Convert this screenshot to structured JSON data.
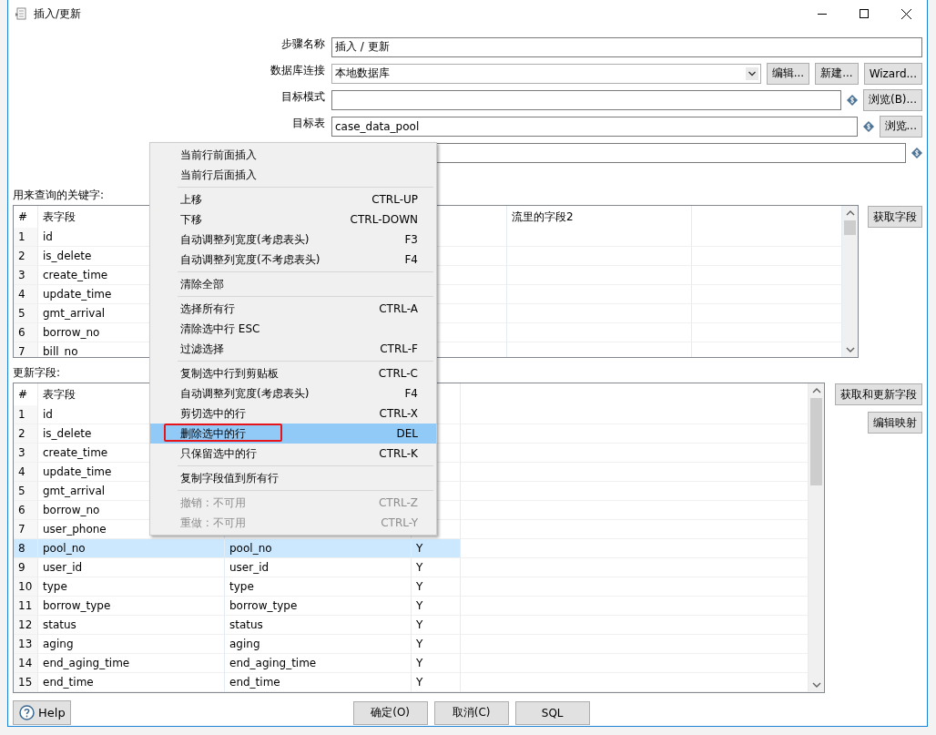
{
  "window": {
    "title": "插入/更新"
  },
  "form": [
    {
      "label": "步骤名称",
      "kind": "text",
      "value": "插入 / 更新"
    },
    {
      "label": "数据库连接",
      "kind": "combo",
      "value": "本地数据库",
      "buttons": [
        "编辑...",
        "新建...",
        "Wizard..."
      ]
    },
    {
      "label": "目标模式",
      "kind": "text",
      "variable": true,
      "buttons": [
        "浏览(B)..."
      ]
    },
    {
      "label": "目标表",
      "kind": "text",
      "value": "case_data_pool",
      "variable": true,
      "buttons": [
        "浏览..."
      ]
    },
    {
      "kind": "text",
      "variable": true
    }
  ],
  "key_section": {
    "title": "用来查询的关键字:",
    "columns": [
      {
        "label": "#"
      },
      {
        "label": "表字段"
      },
      {},
      {},
      {
        "label": "流里的字段2"
      },
      {}
    ],
    "rows": [
      {
        "num": "1",
        "field": "id"
      },
      {
        "num": "2",
        "field": "is_delete"
      },
      {
        "num": "3",
        "field": "create_time"
      },
      {
        "num": "4",
        "field": "update_time"
      },
      {
        "num": "5",
        "field": "gmt_arrival"
      },
      {
        "num": "6",
        "field": "borrow_no"
      },
      {
        "num": "7",
        "field": "bill_no"
      }
    ],
    "button": "获取字段"
  },
  "update_section": {
    "title": "更新字段:",
    "columns": [
      {
        "label": "#"
      },
      {
        "label": "表字段"
      },
      {},
      {},
      {}
    ],
    "rows": [
      {
        "num": "1",
        "field": "id",
        "selected": false
      },
      {
        "num": "2",
        "field": "is_delete",
        "selected": false
      },
      {
        "num": "3",
        "field": "create_time",
        "selected": false
      },
      {
        "num": "4",
        "field": "update_time",
        "selected": false
      },
      {
        "num": "5",
        "field": "gmt_arrival",
        "selected": false
      },
      {
        "num": "6",
        "field": "borrow_no",
        "selected": false
      },
      {
        "num": "7",
        "field": "user_phone",
        "selected": false
      },
      {
        "num": "8",
        "field": "pool_no",
        "stream": "pool_no",
        "update": "Y",
        "selected": true
      },
      {
        "num": "9",
        "field": "user_id",
        "stream": "user_id",
        "update": "Y",
        "selected": false
      },
      {
        "num": "10",
        "field": "type",
        "stream": "type",
        "update": "Y",
        "selected": false
      },
      {
        "num": "11",
        "field": "borrow_type",
        "stream": "borrow_type",
        "update": "Y",
        "selected": false
      },
      {
        "num": "12",
        "field": "status",
        "stream": "status",
        "update": "Y",
        "selected": false
      },
      {
        "num": "13",
        "field": "aging",
        "stream": "aging",
        "update": "Y",
        "selected": false
      },
      {
        "num": "14",
        "field": "end_aging_time",
        "stream": "end_aging_time",
        "update": "Y",
        "selected": false
      },
      {
        "num": "15",
        "field": "end_time",
        "stream": "end_time",
        "update": "Y",
        "selected": false
      }
    ],
    "buttons": [
      "获取和更新字段",
      "编辑映射"
    ]
  },
  "footer": {
    "help": "Help",
    "buttons": [
      "确定(O)",
      "取消(C)",
      "SQL"
    ]
  },
  "context_menu": [
    {
      "kind": "item",
      "label": "当前行前面插入",
      "disabled": false,
      "selected": false
    },
    {
      "kind": "item",
      "label": "当前行后面插入",
      "disabled": false,
      "selected": false
    },
    {
      "kind": "separator"
    },
    {
      "kind": "item",
      "label": "上移",
      "shortcut": "CTRL-UP",
      "disabled": false,
      "selected": false
    },
    {
      "kind": "item",
      "label": "下移",
      "shortcut": "CTRL-DOWN",
      "disabled": false,
      "selected": false
    },
    {
      "kind": "item",
      "label": "自动调整列宽度(考虑表头)",
      "shortcut": "F3",
      "disabled": false,
      "selected": false
    },
    {
      "kind": "item",
      "label": "自动调整列宽度(不考虑表头)",
      "shortcut": "F4",
      "disabled": false,
      "selected": false
    },
    {
      "kind": "separator"
    },
    {
      "kind": "item",
      "label": "清除全部",
      "disabled": false,
      "selected": false
    },
    {
      "kind": "separator"
    },
    {
      "kind": "item",
      "label": "选择所有行",
      "shortcut": "CTRL-A",
      "disabled": false,
      "selected": false
    },
    {
      "kind": "item",
      "label": "清除选中行 ESC",
      "disabled": false,
      "selected": false
    },
    {
      "kind": "item",
      "label": "过滤选择",
      "shortcut": "CTRL-F",
      "disabled": false,
      "selected": false
    },
    {
      "kind": "separator"
    },
    {
      "kind": "item",
      "label": "复制选中行到剪贴板",
      "shortcut": "CTRL-C",
      "disabled": false,
      "selected": false
    },
    {
      "kind": "item",
      "label": "自动调整列宽度(考虑表头)",
      "shortcut": "F4",
      "disabled": false,
      "selected": false
    },
    {
      "kind": "item",
      "label": "剪切选中的行",
      "shortcut": "CTRL-X",
      "disabled": false,
      "selected": false
    },
    {
      "kind": "item",
      "label": "删除选中的行",
      "shortcut": "DEL",
      "disabled": false,
      "selected": true,
      "annotated": true
    },
    {
      "kind": "item",
      "label": "只保留选中的行",
      "shortcut": "CTRL-K",
      "disabled": false,
      "selected": false
    },
    {
      "kind": "separator"
    },
    {
      "kind": "item",
      "label": "复制字段值到所有行",
      "disabled": false,
      "selected": false
    },
    {
      "kind": "separator"
    },
    {
      "kind": "item",
      "label": "撤销 : 不可用",
      "shortcut": "CTRL-Z",
      "disabled": true,
      "selected": false
    },
    {
      "kind": "item",
      "label": "重做 : 不可用",
      "shortcut": "CTRL-Y",
      "disabled": true,
      "selected": false
    }
  ]
}
